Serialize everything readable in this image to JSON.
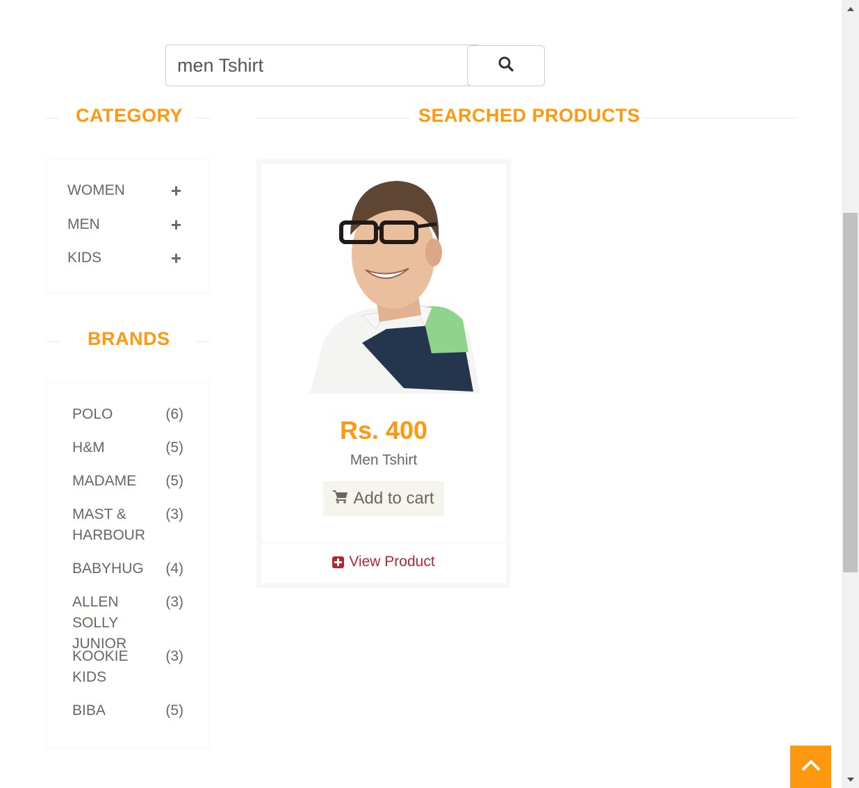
{
  "search": {
    "value": "men Tshirt",
    "button_icon": "search-icon"
  },
  "category": {
    "title": "CATEGORY",
    "items": [
      {
        "label": "WOMEN",
        "icon": "plus-icon"
      },
      {
        "label": "MEN",
        "icon": "plus-icon"
      },
      {
        "label": "KIDS",
        "icon": "plus-icon"
      }
    ]
  },
  "brands": {
    "title": "BRANDS",
    "items": [
      {
        "name": "POLO",
        "count": "(6)"
      },
      {
        "name": "H&M",
        "count": "(5)"
      },
      {
        "name": "MADAME",
        "count": "(5)"
      },
      {
        "name": "MAST & HARBOUR",
        "count": "(3)"
      },
      {
        "name": "BABYHUG",
        "count": "(4)"
      },
      {
        "name": "ALLEN SOLLY JUNIOR",
        "count": "(3)"
      },
      {
        "name": "KOOKIE KIDS",
        "count": "(3)"
      },
      {
        "name": "BIBA",
        "count": "(5)"
      }
    ]
  },
  "products": {
    "title": "SEARCHED PRODUCTS",
    "items": [
      {
        "price": "Rs. 400",
        "name": "Men Tshirt",
        "add_to_cart_label": "Add to cart",
        "view_label": "View Product"
      }
    ]
  },
  "colors": {
    "accent": "#fe980f",
    "link": "#b3272d",
    "text": "#696763"
  }
}
